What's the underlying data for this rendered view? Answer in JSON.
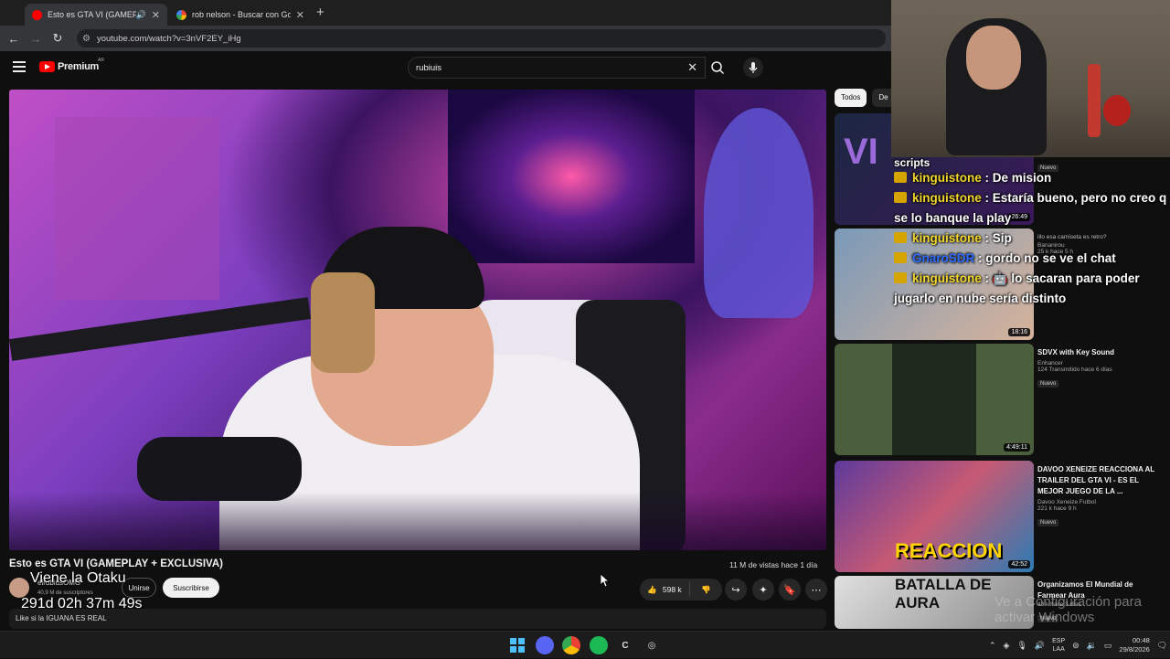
{
  "browser": {
    "tabs": [
      {
        "title": "Esto es GTA VI (GAMEPLAY",
        "active": true
      },
      {
        "title": "rob nelson - Buscar con Google",
        "active": false
      }
    ],
    "url": "youtube.com/watch?v=3nVF2EY_iHg"
  },
  "masthead": {
    "logo_text": "Premium",
    "country_code": "AR",
    "search_value": "rubiuis"
  },
  "chips": [
    "Todos",
    "De"
  ],
  "video": {
    "title": "Esto es GTA VI (GAMEPLAY + EXCLUSIVA)",
    "views": "11 M de vistas  hace 1 día",
    "channel": "elrubiusOMG",
    "subscribers": "40,9 M de suscriptores",
    "join_label": "Unirse",
    "subscribe_label": "Suscribirse",
    "likes": "598 k",
    "description": "Like si la IGUANA ES REAL",
    "overlay_title": "Viene la Otaku",
    "overlay_timer": "291d 02h 37m 49s"
  },
  "sidebar": {
    "cards": [
      {
        "title": "",
        "channel": "",
        "meta": "",
        "badge": "Nuevo",
        "duration": "26:49"
      },
      {
        "title": "",
        "channel": "Bananirou",
        "meta": "25 k  hace 5 h",
        "partial_title": "illo esa camiseta es retro?",
        "duration": "18:16"
      },
      {
        "title": "SDVX with Key Sound",
        "channel": "Enhancer",
        "meta": "124  Transmitido hace 6 días",
        "badge": "Nuevo",
        "duration": "4:49:11"
      },
      {
        "title": "DAVOO XENEIZE REACCIONA AL TRAILER DEL GTA VI - ES EL MEJOR JUEGO DE LA ...",
        "channel": "Davoo Xeneize Futbol",
        "meta": "221 k  hace 9 h",
        "badge": "Nuevo",
        "duration": "42:52",
        "thumb_text": "REACCION"
      },
      {
        "title": "Organizamos El Mundial de Farmear Aura",
        "channel": "",
        "meta": "43 k  hace 3 días",
        "badge": "Nuevo",
        "thumb_text": "BATALLA DE AURA"
      }
    ]
  },
  "chat": [
    {
      "user": "",
      "text": "scripts",
      "partial": true
    },
    {
      "user": "kinguistone",
      "text": " : De mision"
    },
    {
      "user": "kinguistone",
      "text": " : Estaría bueno, pero no creo q se lo banque la play"
    },
    {
      "user": "kinguistone",
      "text": " : Sip"
    },
    {
      "user": "GnaroSDR",
      "text": " : gordo no se ve el chat",
      "blue": true
    },
    {
      "user": "kinguistone",
      "text": " : 🤖 lo sacaran para poder jugarlo en nube sería distinto"
    }
  ],
  "watermark": "Ve a Configuración para activar Windows",
  "taskbar": {
    "lang_1": "ESP",
    "lang_2": "LAA",
    "time": "00:48",
    "date": "29/8/2026"
  },
  "colors": {
    "yt_red": "#ff0000",
    "chat_user": "#f2d62e",
    "chat_user_alt": "#2f6bff"
  }
}
